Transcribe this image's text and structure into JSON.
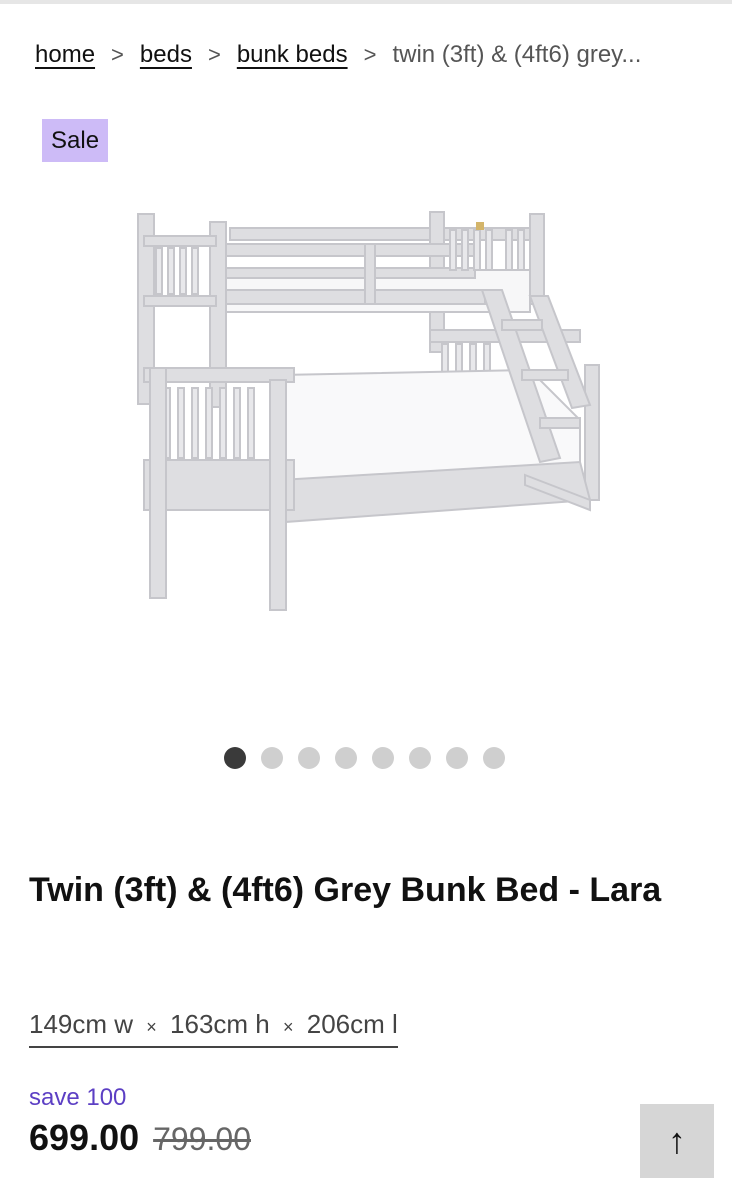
{
  "breadcrumb": {
    "items": [
      "home",
      "beds",
      "bunk beds"
    ],
    "current": "twin (3ft) & (4ft6) grey...",
    "separator": ">"
  },
  "product": {
    "badge": "Sale",
    "title": "Twin (3ft) & (4ft6) Grey Bunk Bed - Lara",
    "dimensions": {
      "w": "149cm w",
      "h": "163cm h",
      "l": "206cm l",
      "sep": "×"
    },
    "save_text": "save 100",
    "price": "699.00",
    "was_price": "799.00"
  },
  "gallery": {
    "count": 8,
    "active_index": 0,
    "image_icon": "grey-bunk-bed-image"
  },
  "back_to_top": {
    "icon": "arrow-up-icon",
    "glyph": "↑"
  },
  "colors": {
    "accent": "#5c3fc4",
    "badge_bg": "#cdbbf7",
    "bed_frame": "#d9d9dc"
  }
}
